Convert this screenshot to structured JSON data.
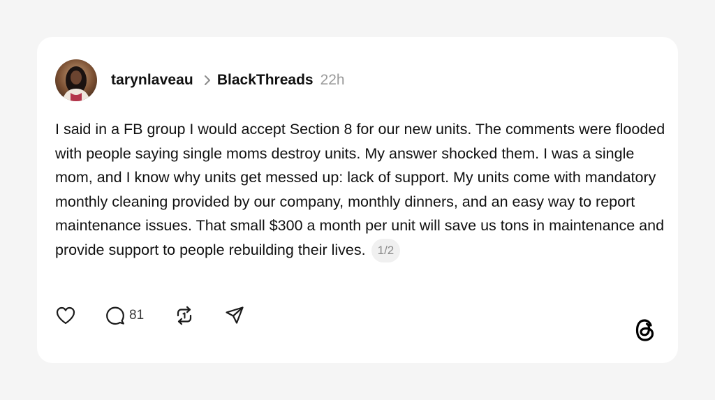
{
  "post": {
    "author": "tarynlaveau",
    "topic": "BlackThreads",
    "time": "22h",
    "text": "I said in a FB group I would accept Section 8 for our new units. The comments were flooded with people saying single moms destroy units. My answer shocked them. I was a single mom, and I know why units get messed up: lack of support. My units come with mandatory monthly cleaning provided by our company, monthly dinners, and an easy way to report maintenance issues. That small $300 a month per unit will save us tons in maintenance and provide support to people rebuilding their lives.",
    "pager": "1/2"
  },
  "actions": {
    "reply_count": "81"
  },
  "icons": {
    "like": "heart-icon",
    "reply": "comment-icon",
    "repost": "repost-icon",
    "share": "send-icon",
    "chevron": "chevron-right-icon",
    "logo": "threads-logo"
  },
  "colors": {
    "background": "#f5f5f5",
    "card": "#ffffff",
    "text": "#101010",
    "muted": "#9a9a9a"
  }
}
